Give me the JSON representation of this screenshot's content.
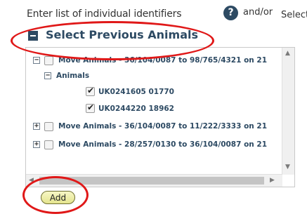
{
  "header": {
    "instruction_text": "Enter list of individual identifiers",
    "help_glyph": "?",
    "and_or_text": "and/or",
    "select_text": "Select"
  },
  "section": {
    "title": "Select Previous Animals",
    "collapse_icon": "minus-square-icon"
  },
  "tree": {
    "nodes": [
      {
        "toggle": "−",
        "label": "Move Animals - 36/104/0087 to 98/765/4321 on 21",
        "checked": false
      },
      {
        "toggle": "−",
        "label": "Animals"
      },
      {
        "label": "UK0241605 01770",
        "checked": true
      },
      {
        "label": "UK0244220 18962",
        "checked": true
      },
      {
        "toggle": "+",
        "label": "Move Animals - 36/104/0087 to 11/222/3333 on 21",
        "checked": false
      },
      {
        "toggle": "+",
        "label": "Move Animals - 28/257/0130 to 36/104/0087 on 21",
        "checked": false
      }
    ]
  },
  "scrollbars": {
    "up_arrow": "▲",
    "down_arrow": "▼",
    "left_arrow": "◀",
    "right_arrow": "▶"
  },
  "actions": {
    "add_label": "Add"
  },
  "colors": {
    "highlight": "#e01818",
    "title": "#2d4a63",
    "button": "#eaea9e"
  }
}
